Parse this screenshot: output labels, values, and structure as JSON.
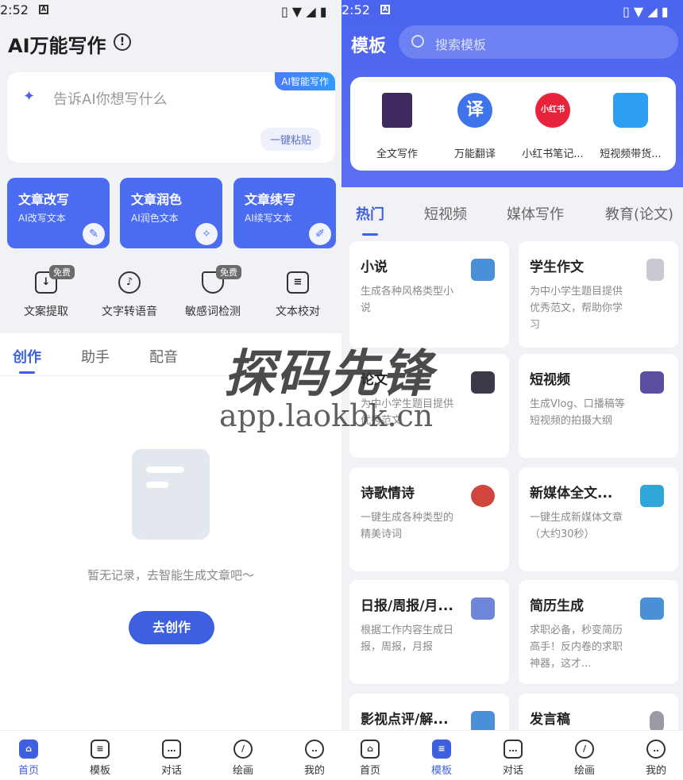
{
  "left": {
    "status": {
      "time": "2:52",
      "notif": "A"
    },
    "title": "AI万能写作",
    "info_icon": "info-icon",
    "ai_card": {
      "badge": "AI智能写作",
      "placeholder": "告诉AI你想写什么",
      "paste_label": "一键粘贴"
    },
    "features": [
      {
        "title": "文章改写",
        "sub": "AI改写文本",
        "icon": "edit-icon"
      },
      {
        "title": "文章润色",
        "sub": "AI润色文本",
        "icon": "magic-wand-icon"
      },
      {
        "title": "文章续写",
        "sub": "AI续写文本",
        "icon": "note-edit-icon"
      }
    ],
    "tools": [
      {
        "label": "文案提取",
        "badge": "免费",
        "icon": "download-box-icon"
      },
      {
        "label": "文字转语音",
        "badge": "",
        "icon": "microphone-icon"
      },
      {
        "label": "敏感词检测",
        "badge": "免费",
        "icon": "shield-icon"
      },
      {
        "label": "文本校对",
        "badge": "",
        "icon": "clipboard-icon"
      }
    ],
    "tabs": [
      "创作",
      "助手",
      "配音"
    ],
    "empty_text": "暂无记录，去智能生成文章吧～",
    "create_button": "去创作",
    "nav": [
      {
        "label": "首页",
        "icon": "home-icon",
        "active": true
      },
      {
        "label": "模板",
        "icon": "template-icon",
        "active": false
      },
      {
        "label": "对话",
        "icon": "chat-icon",
        "active": false
      },
      {
        "label": "绘画",
        "icon": "brush-icon",
        "active": false
      },
      {
        "label": "我的",
        "icon": "profile-icon",
        "active": false
      }
    ]
  },
  "right": {
    "status": {
      "time": "2:52",
      "notif": "A"
    },
    "title": "模板",
    "search_placeholder": "搜索模板",
    "top_templates": [
      {
        "label": "全文写作",
        "icon": "notebook-icon",
        "color": "#3e2a5e",
        "glyph": ""
      },
      {
        "label": "万能翻译",
        "icon": "translate-icon",
        "color": "#3f73ea",
        "glyph": "译"
      },
      {
        "label": "小红书笔记...",
        "icon": "xiaohongshu-icon",
        "color": "#e8243d",
        "glyph": "小红书"
      },
      {
        "label": "短视频带货...",
        "icon": "shopping-bag-icon",
        "color": "#2e9ff0",
        "glyph": ""
      }
    ],
    "categories": [
      "热门",
      "短视频",
      "媒体写作",
      "教育(论文)"
    ],
    "cards": [
      {
        "title": "小说",
        "desc": "生成各种风格类型小说",
        "icon": "book-icon",
        "color": "#4a90d9"
      },
      {
        "title": "学生作文",
        "desc": "为中小学生题目提供优秀范文，帮助你学习",
        "icon": "document-icon",
        "color": "#c9c9d1"
      },
      {
        "title": "论文",
        "desc": "为中小学生题目提供优秀范文",
        "icon": "graduation-cap-icon",
        "color": "#3a3a48"
      },
      {
        "title": "短视频",
        "desc": "生成Vlog、口播稿等短视频的拍摄大纲",
        "icon": "clapperboard-icon",
        "color": "#5b4da0"
      },
      {
        "title": "诗歌情诗",
        "desc": "一键生成各种类型的精美诗词",
        "icon": "poetry-icon",
        "color": "#d0453e"
      },
      {
        "title": "新媒体全文...",
        "desc": "一键生成新媒体文章（大约30秒）",
        "icon": "monitor-icon",
        "color": "#2fa5d8"
      },
      {
        "title": "日报/周报/月...",
        "desc": "根据工作内容生成日报，周报，月报",
        "icon": "calendar-icon",
        "color": "#6f86d8"
      },
      {
        "title": "简历生成",
        "desc": "求职必备，秒变简历高手！反内卷的求职神器，这才...",
        "icon": "book-icon",
        "color": "#4a90d9"
      },
      {
        "title": "影视点评/解...",
        "desc": "",
        "icon": "book-icon",
        "color": "#4a90d9"
      },
      {
        "title": "发言稿",
        "desc": "",
        "icon": "microphone-icon",
        "color": "#9a9aa6"
      }
    ],
    "nav": [
      {
        "label": "首页",
        "icon": "home-icon",
        "active": false
      },
      {
        "label": "模板",
        "icon": "template-icon",
        "active": true
      },
      {
        "label": "对话",
        "icon": "chat-icon",
        "active": false
      },
      {
        "label": "绘画",
        "icon": "brush-icon",
        "active": false
      },
      {
        "label": "我的",
        "icon": "profile-icon",
        "active": false
      }
    ]
  },
  "watermark": {
    "brand": "探码先锋",
    "url": "app.laokbk.cn"
  },
  "colors": {
    "accent": "#3d5fe0",
    "feature_card": "#4b6cf0",
    "header": "#4a64ee"
  }
}
